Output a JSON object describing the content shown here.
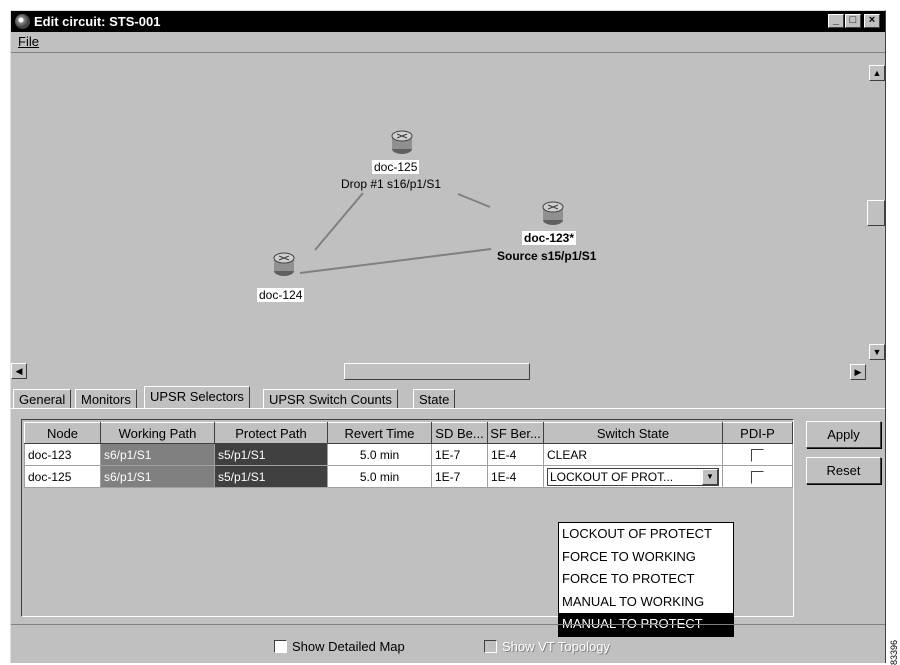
{
  "window": {
    "title": "Edit circuit: STS-001"
  },
  "menu": {
    "file": "File"
  },
  "map": {
    "nodes": [
      {
        "id": "doc-125",
        "label": "doc-125",
        "sublabel": "Drop #1 s16/p1/S1"
      },
      {
        "id": "doc-123",
        "label": "doc-123*",
        "sublabel": "Source s15/p1/S1"
      },
      {
        "id": "doc-124",
        "label": "doc-124",
        "sublabel": ""
      }
    ]
  },
  "tabs": [
    "General",
    "Monitors",
    "UPSR Selectors",
    "UPSR Switch Counts",
    "State"
  ],
  "active_tab": "UPSR Selectors",
  "table": {
    "headers": [
      "Node",
      "Working Path",
      "Protect Path",
      "Revert Time",
      "SD Be...",
      "SF Ber...",
      "Switch State",
      "PDI-P"
    ],
    "rows": [
      {
        "node": "doc-123",
        "working": "s6/p1/S1",
        "protect": "s5/p1/S1",
        "revert": "5.0 min",
        "sd": "1E-7",
        "sf": "1E-4",
        "state": "CLEAR",
        "pdi": false
      },
      {
        "node": "doc-125",
        "working": "s6/p1/S1",
        "protect": "s5/p1/S1",
        "revert": "5.0 min",
        "sd": "1E-7",
        "sf": "1E-4",
        "state": "LOCKOUT OF PROT...",
        "pdi": false
      }
    ]
  },
  "dropdown": {
    "options": [
      "LOCKOUT OF PROTECT",
      "FORCE TO WORKING",
      "FORCE TO PROTECT",
      "MANUAL TO WORKING",
      "MANUAL TO PROTECT"
    ],
    "highlighted": "MANUAL TO PROTECT"
  },
  "buttons": {
    "apply": "Apply",
    "reset": "Reset"
  },
  "bottom": {
    "show_detailed_map": "Show Detailed Map",
    "show_vt_topology": "Show VT Topology"
  },
  "figure_id": "83396"
}
